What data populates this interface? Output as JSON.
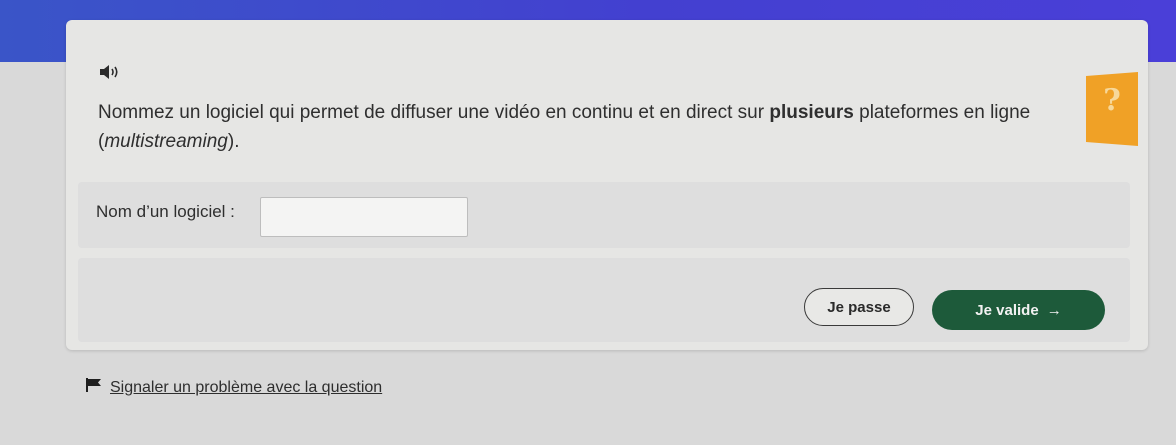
{
  "question": {
    "part1": "Nommez un logiciel qui permet de diffuser une vidéo en continu et en direct sur ",
    "bold": "plusieurs",
    "part2": " plateformes en ligne",
    "paren_open": "(",
    "italic": "multistreaming",
    "paren_close": ")."
  },
  "answer": {
    "label": "Nom d’un logiciel :",
    "value": "",
    "placeholder": ""
  },
  "actions": {
    "skip_label": "Je passe",
    "validate_label": "Je valide",
    "validate_arrow": "→"
  },
  "report": {
    "label": "Signaler un problème avec la question"
  },
  "help": {
    "symbol": "?"
  },
  "colors": {
    "accent_blue": "#3f4bd0",
    "validate_green": "#1d5a3a",
    "help_orange": "#f0a126"
  },
  "icons": {
    "speaker": "speaker-icon",
    "help": "help-icon",
    "flag": "flag-icon",
    "arrow": "arrow-right-icon"
  }
}
